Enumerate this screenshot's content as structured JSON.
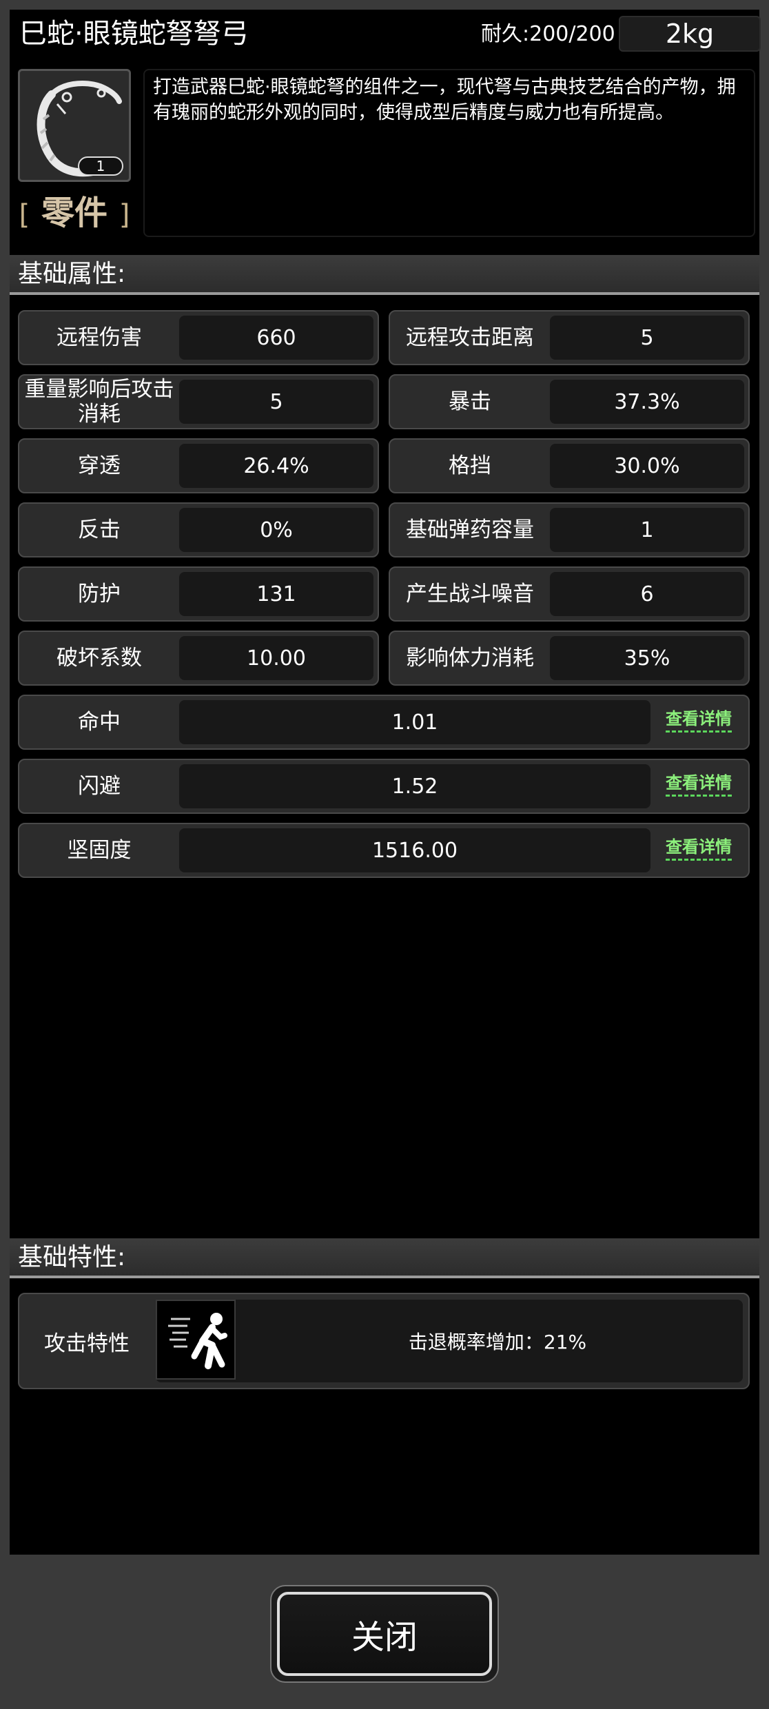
{
  "header": {
    "title": "巳蛇·眼镜蛇弩弩弓",
    "durability": "耐久:200/200",
    "weight": "2kg"
  },
  "item": {
    "count": "1",
    "type_bracket_left": "[",
    "type_label": "零件",
    "type_bracket_right": "]",
    "description": "打造武器巳蛇·眼镜蛇弩的组件之一，现代弩与古典技艺结合的产物，拥有瑰丽的蛇形外观的同时，使得成型后精度与威力也有所提高。"
  },
  "sections": {
    "basic_attributes": "基础属性:",
    "basic_traits": "基础特性:"
  },
  "stats": [
    {
      "label": "远程伤害",
      "value": "660"
    },
    {
      "label": "远程攻击距离",
      "value": "5"
    },
    {
      "label": "重量影响后攻击消耗",
      "value": "5"
    },
    {
      "label": "暴击",
      "value": "37.3%"
    },
    {
      "label": "穿透",
      "value": "26.4%"
    },
    {
      "label": "格挡",
      "value": "30.0%"
    },
    {
      "label": "反击",
      "value": "0%"
    },
    {
      "label": "基础弹药容量",
      "value": "1"
    },
    {
      "label": "防护",
      "value": "131"
    },
    {
      "label": "产生战斗噪音",
      "value": "6"
    },
    {
      "label": "破坏系数",
      "value": "10.00"
    },
    {
      "label": "影响体力消耗",
      "value": "35%"
    }
  ],
  "wide_stats": [
    {
      "label": "命中",
      "value": "1.01",
      "link": "查看详情"
    },
    {
      "label": "闪避",
      "value": "1.52",
      "link": "查看详情"
    },
    {
      "label": "坚固度",
      "value": "1516.00",
      "link": "查看详情"
    }
  ],
  "feature": {
    "label": "攻击特性",
    "icon": "knockback-icon",
    "value": "击退概率增加：21%"
  },
  "close_button": "关闭"
}
